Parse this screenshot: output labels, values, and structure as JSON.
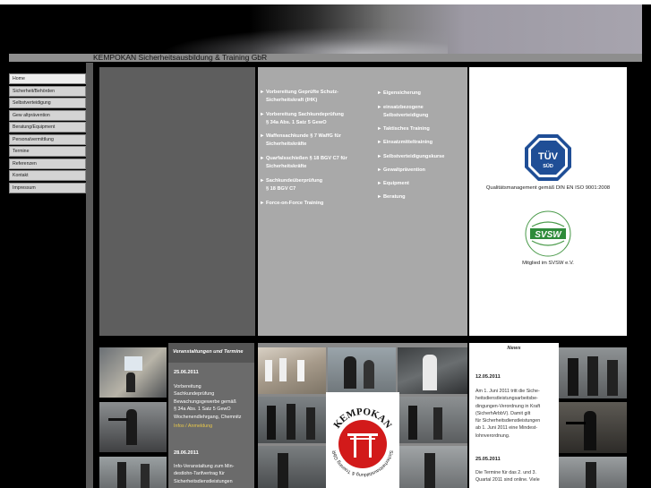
{
  "header": {
    "site_title": "KEMPOKAN Sicherheitsausbildung & Training GbR"
  },
  "nav": {
    "items": [
      {
        "label": "Home",
        "active": true
      },
      {
        "label": "Sicherheit/Behörden"
      },
      {
        "label": "Selbstverteidigung"
      },
      {
        "label": "Gew altprävention"
      },
      {
        "label": "Beratung/Equipment"
      },
      {
        "label": "Personalvermittlung"
      },
      {
        "label": "Termine"
      },
      {
        "label": "Referenzen"
      },
      {
        "label": "Kontakt"
      },
      {
        "label": "Impressum"
      }
    ]
  },
  "services": {
    "arrow": "►",
    "left": [
      {
        "line1": "Vorbereitung Geprüfte Schutz-",
        "line2": "Sicherheitskraft (IHK)"
      },
      {
        "line1": "Vorbereitung Sachkundeprüfung",
        "line2": "§ 34a Abs. 1 Satz 5 GewO"
      },
      {
        "line1": "Waffensachkunde § 7 WaffG für",
        "line2": "Sicherheitskräfte"
      },
      {
        "line1": "Quarfalsschießen § 18 BGV C7 für",
        "line2": "Sicherheitskräfte"
      },
      {
        "line1": "Sachkundeüberprüfung",
        "line2": "§ 18 BGV C7"
      },
      {
        "line1": "Force-on-Force Training",
        "line2": ""
      }
    ],
    "right": [
      {
        "line1": "Eigensicherung",
        "line2": ""
      },
      {
        "line1": "einsatzbezogene",
        "line2": "Selbstverteidigung"
      },
      {
        "line1": "Taktisches Training",
        "line2": ""
      },
      {
        "line1": "Einsatzmitteltraining",
        "line2": ""
      },
      {
        "line1": "Selbstverteidigungskurse",
        "line2": ""
      },
      {
        "line1": "Gewaltprävention",
        "line2": ""
      },
      {
        "line1": "Equipment",
        "line2": ""
      },
      {
        "line1": "Beratung",
        "line2": ""
      }
    ]
  },
  "cert": {
    "tuv_logo_text": "TÜV",
    "tuv_sub": "SÜD",
    "tuv_caption": "Qualitätsmanagement gemäß DIN EN ISO 9001:2008",
    "svsw_logo_text": "SVSW",
    "svsw_caption": "Mitglied im SVSW e.V."
  },
  "events": {
    "heading": "Veranstaltungen und Termine",
    "items": [
      {
        "date": "25.06.2011",
        "text": "Vorbereitung\nSachkundeprüfung\nBewachungsgewerbe gemäß\n§ 34a Abs. 1 Satz 5 GewO\nWochenendlehrgang, Chemnitz",
        "links": "Infos / Anmeldung"
      },
      {
        "date": "28.06.2011",
        "text": "Info-Veranstaltung zum Min-\ndestlohn-Tarifvertrag für\nSicherheitsdienstleistungen",
        "links": ""
      }
    ]
  },
  "logo": {
    "name": "KEMPOKAN",
    "tagline": "Sicherheitsausbildung & Training GbR"
  },
  "news": {
    "heading": "News",
    "items": [
      {
        "date": "12.05.2011",
        "text": "Am 1. Juni 2011 tritt die Siche-\nheitsdienstleistungsarbeitsbe-\ndingungen-Verordnung in Kraft\n(SicherhArbbV). Damit gilt\nfür Sicherheitsdienstleistungen\nab 1. Juni 2011 eine Mindest-\nlohnverordnung."
      },
      {
        "date": "25.05.2011",
        "text": "Die Termine für das 2. und 3.\nQuartal 2011 sind online. Viele"
      }
    ]
  },
  "colors": {
    "accent": "#e8c84a",
    "logo_red": "#d21a1a"
  }
}
